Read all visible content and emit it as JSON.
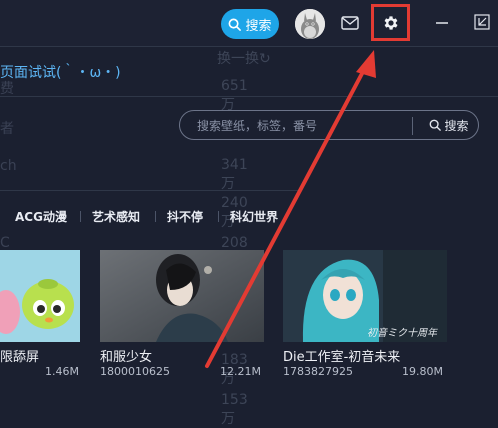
{
  "header": {
    "search_button_label": "搜索"
  },
  "banner": {
    "title": "页面试试(｀・ω・)"
  },
  "search": {
    "placeholder": "搜索壁纸，标签，番号",
    "button_label": "搜索"
  },
  "tags": [
    "ACG动漫",
    "艺术感知",
    "抖不停",
    "科幻世界"
  ],
  "cards": [
    {
      "title": "限舔屏",
      "id": "",
      "size": "1.46M"
    },
    {
      "title": "和服少女",
      "id": "1800010625",
      "size": "12.21M"
    },
    {
      "title": "Die工作室-初音未来",
      "id": "1783827925",
      "size": "19.80M",
      "watermark": "初音ミク十周年"
    }
  ],
  "background_list": {
    "left_items": [
      "费",
      "者",
      "ch",
      "C"
    ],
    "mid_items": [
      "换一换↻",
      "651万",
      "341万",
      "240万",
      "208万",
      "183万",
      "153万"
    ]
  },
  "colors": {
    "accent": "#1ea5e8",
    "highlight": "#e33b33",
    "link": "#5db6f5"
  },
  "icons": [
    "search-icon",
    "mail-icon",
    "gear-icon",
    "minimize-icon",
    "restore-icon"
  ]
}
